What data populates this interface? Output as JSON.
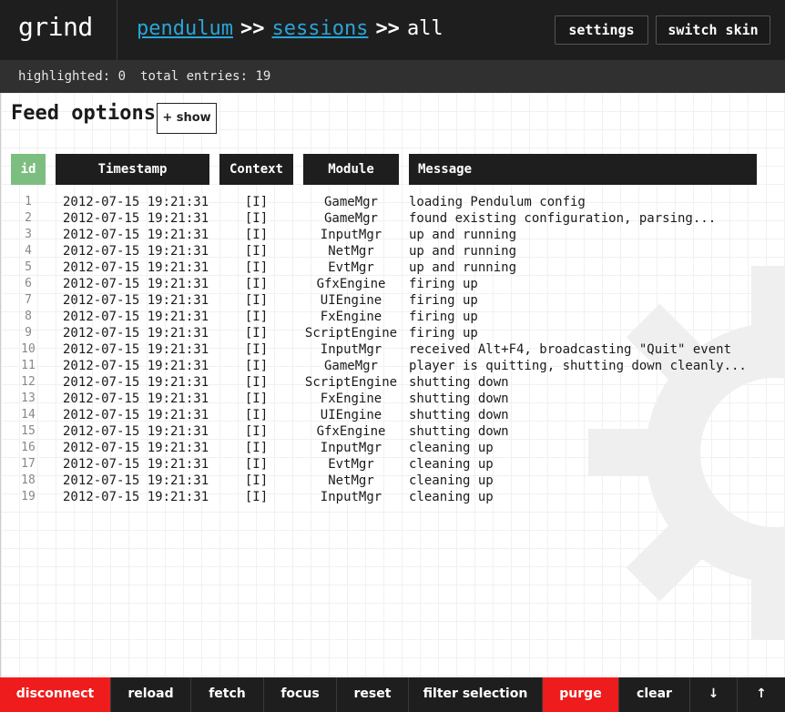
{
  "header": {
    "logo": "grind",
    "breadcrumb": [
      {
        "label": "pendulum"
      },
      {
        "label": "sessions"
      },
      {
        "label": "all"
      }
    ],
    "separator": ">>",
    "buttons": {
      "settings": "settings",
      "switch_skin": "switch skin"
    }
  },
  "status": {
    "highlighted": "highlighted: 0",
    "total": "total entries: 19"
  },
  "feed": {
    "title": "Feed options",
    "show_button": "+ show"
  },
  "table": {
    "headers": {
      "id": "id",
      "timestamp": "Timestamp",
      "context": "Context",
      "module": "Module",
      "message": "Message"
    },
    "rows": [
      {
        "id": "1",
        "timestamp": "2012-07-15 19:21:31",
        "context": "[I]",
        "module": "GameMgr",
        "message": "loading Pendulum config"
      },
      {
        "id": "2",
        "timestamp": "2012-07-15 19:21:31",
        "context": "[I]",
        "module": "GameMgr",
        "message": "found existing configuration, parsing..."
      },
      {
        "id": "3",
        "timestamp": "2012-07-15 19:21:31",
        "context": "[I]",
        "module": "InputMgr",
        "message": "up and running"
      },
      {
        "id": "4",
        "timestamp": "2012-07-15 19:21:31",
        "context": "[I]",
        "module": "NetMgr",
        "message": "up and running"
      },
      {
        "id": "5",
        "timestamp": "2012-07-15 19:21:31",
        "context": "[I]",
        "module": "EvtMgr",
        "message": "up and running"
      },
      {
        "id": "6",
        "timestamp": "2012-07-15 19:21:31",
        "context": "[I]",
        "module": "GfxEngine",
        "message": "firing up"
      },
      {
        "id": "7",
        "timestamp": "2012-07-15 19:21:31",
        "context": "[I]",
        "module": "UIEngine",
        "message": "firing up"
      },
      {
        "id": "8",
        "timestamp": "2012-07-15 19:21:31",
        "context": "[I]",
        "module": "FxEngine",
        "message": "firing up"
      },
      {
        "id": "9",
        "timestamp": "2012-07-15 19:21:31",
        "context": "[I]",
        "module": "ScriptEngine",
        "message": "firing up"
      },
      {
        "id": "10",
        "timestamp": "2012-07-15 19:21:31",
        "context": "[I]",
        "module": "InputMgr",
        "message": "received Alt+F4, broadcasting \"Quit\" event"
      },
      {
        "id": "11",
        "timestamp": "2012-07-15 19:21:31",
        "context": "[I]",
        "module": "GameMgr",
        "message": "player is quitting, shutting down cleanly..."
      },
      {
        "id": "12",
        "timestamp": "2012-07-15 19:21:31",
        "context": "[I]",
        "module": "ScriptEngine",
        "message": "shutting down"
      },
      {
        "id": "13",
        "timestamp": "2012-07-15 19:21:31",
        "context": "[I]",
        "module": "FxEngine",
        "message": "shutting down"
      },
      {
        "id": "14",
        "timestamp": "2012-07-15 19:21:31",
        "context": "[I]",
        "module": "UIEngine",
        "message": "shutting down"
      },
      {
        "id": "15",
        "timestamp": "2012-07-15 19:21:31",
        "context": "[I]",
        "module": "GfxEngine",
        "message": "shutting down"
      },
      {
        "id": "16",
        "timestamp": "2012-07-15 19:21:31",
        "context": "[I]",
        "module": "InputMgr",
        "message": "cleaning up"
      },
      {
        "id": "17",
        "timestamp": "2012-07-15 19:21:31",
        "context": "[I]",
        "module": "EvtMgr",
        "message": "cleaning up"
      },
      {
        "id": "18",
        "timestamp": "2012-07-15 19:21:31",
        "context": "[I]",
        "module": "NetMgr",
        "message": "cleaning up"
      },
      {
        "id": "19",
        "timestamp": "2012-07-15 19:21:31",
        "context": "[I]",
        "module": "InputMgr",
        "message": "cleaning up"
      }
    ]
  },
  "footer": {
    "disconnect": "disconnect",
    "reload": "reload",
    "fetch": "fetch",
    "focus": "focus",
    "reset": "reset",
    "filter_selection": "filter selection",
    "purge": "purge",
    "clear": "clear",
    "scroll_down": "↓",
    "scroll_up": "↑"
  },
  "colors": {
    "header_bg": "#1e1e1e",
    "link": "#29a5d8",
    "id_header": "#7cbe80",
    "danger": "#ee1c1c"
  },
  "icons": {
    "background": "gear-icon",
    "scroll_down": "arrow-down-icon",
    "scroll_up": "arrow-up-icon"
  }
}
